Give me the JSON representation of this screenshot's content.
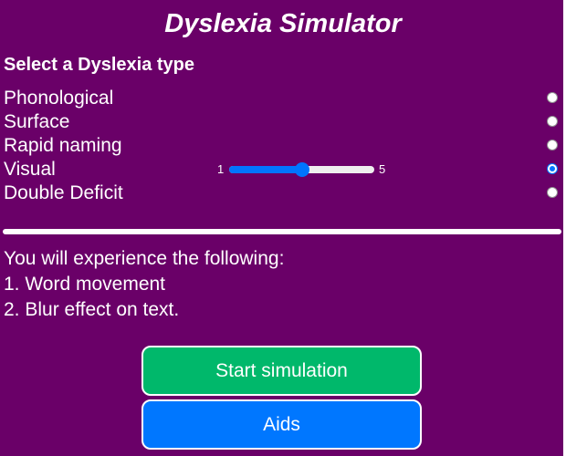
{
  "app": {
    "title": "Dyslexia Simulator"
  },
  "selection": {
    "heading": "Select a Dyslexia type",
    "options": [
      {
        "label": "Phonological",
        "checked": false
      },
      {
        "label": "Surface",
        "checked": false
      },
      {
        "label": "Rapid naming",
        "checked": false
      },
      {
        "label": "Visual",
        "checked": true
      },
      {
        "label": "Double Deficit",
        "checked": false
      }
    ]
  },
  "slider": {
    "min_label": "1",
    "max_label": "5",
    "min": 1,
    "max": 5,
    "value": 3
  },
  "info": {
    "intro": "You will experience the following:",
    "items": [
      "1. Word movement",
      "2. Blur effect on text."
    ]
  },
  "buttons": {
    "start_label": "Start simulation",
    "aids_label": "Aids"
  },
  "colors": {
    "background": "#6a0068",
    "start_button": "#00b86b",
    "aids_button": "#0077ff",
    "accent": "#0075ff"
  }
}
